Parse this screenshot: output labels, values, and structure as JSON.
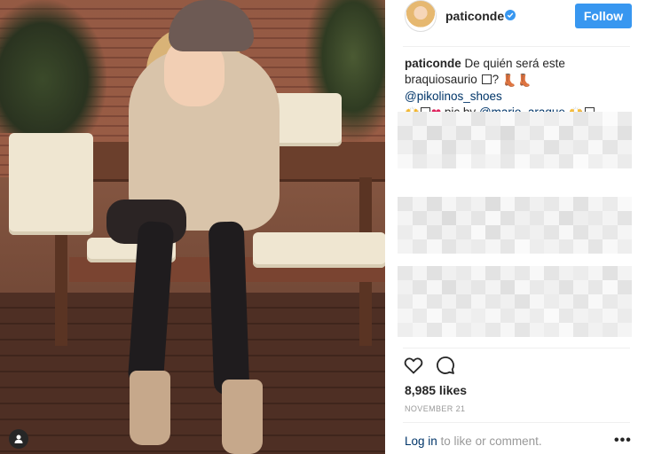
{
  "post": {
    "username": "paticonde",
    "follow_label": "Follow",
    "caption_user": "paticonde",
    "caption_text_1": " De quién será este braquiosaurio ",
    "caption_text_2": "? ",
    "mention_1": "@pikolinos_shoes",
    "caption_text_3": " pic by ",
    "mention_2": "@mario_araque",
    "likes": "8,985 likes",
    "date": "NOVEMBER 21",
    "login_link": "Log in",
    "login_rest": " to like or comment.",
    "more_label": "•••"
  },
  "icons": {
    "verified": "verified-badge-icon",
    "like": "heart-icon",
    "comment": "comment-bubble-icon",
    "profile_tag": "person-icon"
  },
  "colors": {
    "accent": "#3897f0",
    "link": "#003569",
    "muted": "#999999",
    "text": "#262626"
  }
}
